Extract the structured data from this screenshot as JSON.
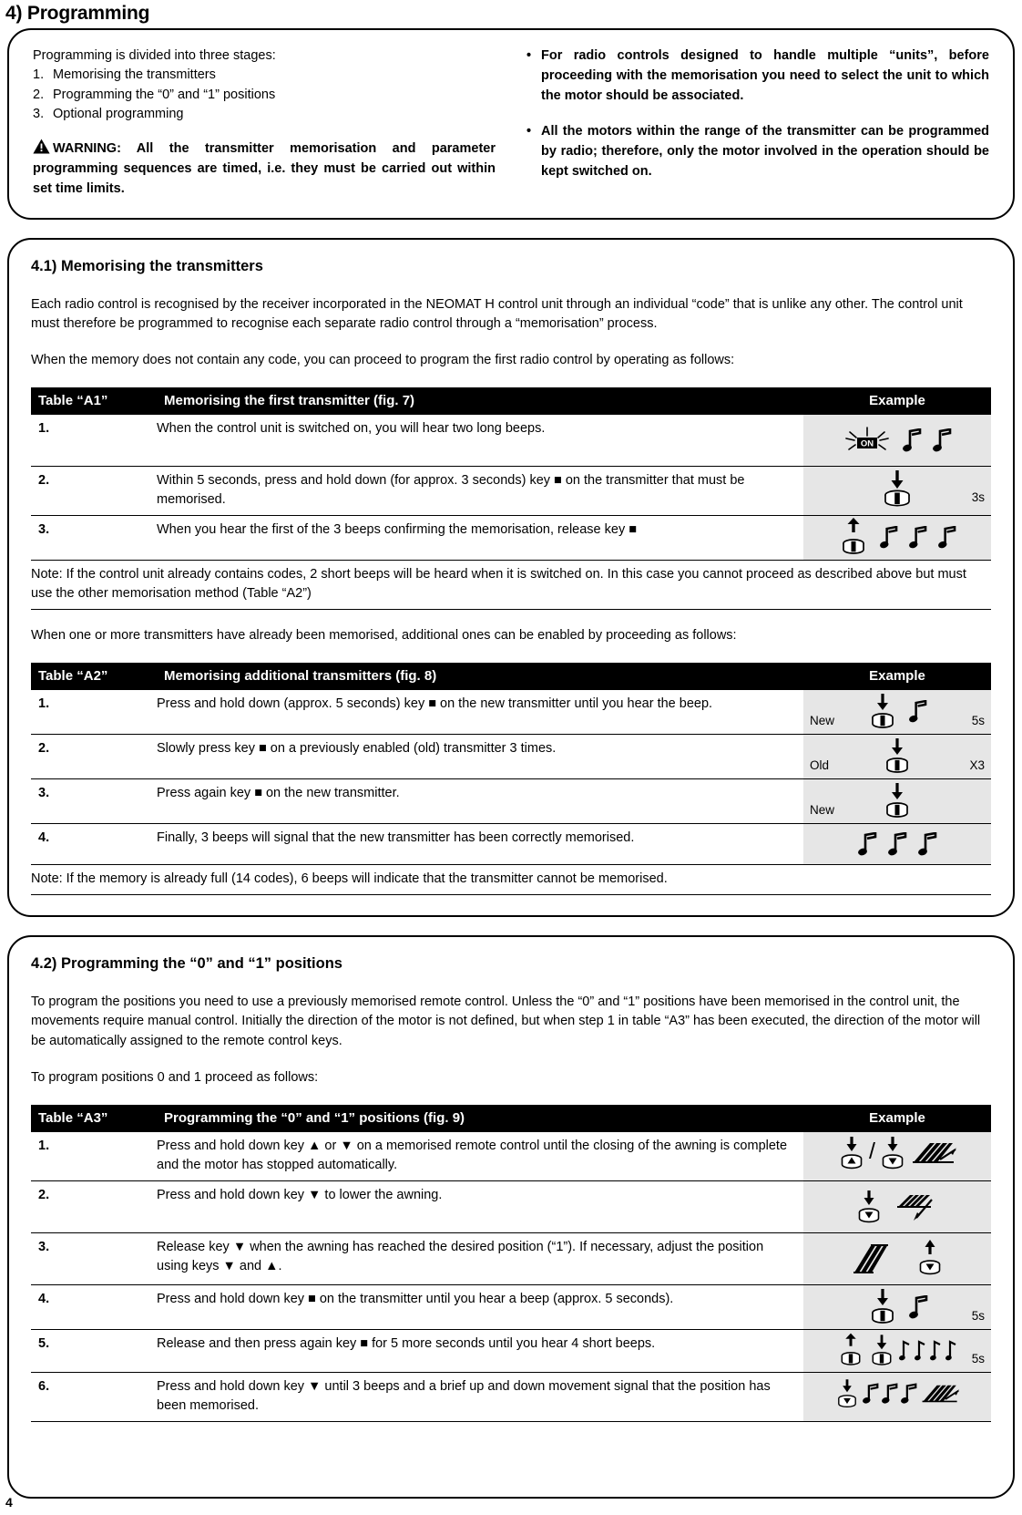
{
  "page": {
    "section_number_title": "4) Programming",
    "folio": "4"
  },
  "intro": {
    "lead": "Programming is divided into three stages:",
    "stages": [
      {
        "num": "1.",
        "text": "Memorising the transmitters"
      },
      {
        "num": "2.",
        "text": "Programming the “0” and “1” positions"
      },
      {
        "num": "3.",
        "text": "Optional programming"
      }
    ],
    "warning_icon": "warning-triangle-icon",
    "warning": "WARNING: All the transmitter memorisation and parameter programming sequences are timed, i.e. they must be carried out within set time limits.",
    "bullets": [
      "For radio controls designed to handle multiple “units”, before proceeding with the memorisation you need to select the unit to which the motor should be associated.",
      "All the motors within the range of the transmitter can be programmed by radio; therefore, only the motor involved in the operation should be kept switched on."
    ]
  },
  "section_41": {
    "title": "4.1) Memorising the transmitters",
    "para1": "Each radio control is recognised by the receiver incorporated in the NEOMAT H control unit through an individual “code” that is unlike any other. The control unit must therefore be programmed to recognise each separate radio control through a “memorisation” process.",
    "para2": "When the memory does not contain any code, you can proceed to program the first radio control by operating as follows:",
    "table_a1": {
      "header": {
        "label": "Table “A1”",
        "title": "Memorising the first transmitter (fig. 7)",
        "example": "Example"
      },
      "rows": [
        {
          "step": "1.",
          "desc": "When the control unit is switched on, you will hear two long beeps.",
          "example_icons": "on-burst-icon, beep-note-icon, beep-note-icon"
        },
        {
          "step": "2.",
          "desc": "Within 5 seconds, press and hold down (for approx. 3 seconds) key ■ on the transmitter that must be memorised.",
          "example_icons": "arrow-down-icon, stop-key-button-icon",
          "example_right": "3s"
        },
        {
          "step": "3.",
          "desc": "When you hear the first of the 3 beeps confirming the memorisation, release key ■",
          "example_icons": "arrow-up-icon, stop-key-button-icon, beep-note-icon, beep-note-icon, beep-note-icon"
        }
      ],
      "note": "Note: If the control unit already contains codes, 2 short beeps will be heard when it is switched on. In this case you cannot proceed as described above but must use the other memorisation method (Table “A2”)"
    },
    "para3": "When one or more transmitters have already been memorised, additional ones can be enabled by proceeding as follows:",
    "table_a2": {
      "header": {
        "label": "Table “A2”",
        "title": "Memorising additional transmitters (fig. 8)",
        "example": "Example"
      },
      "rows": [
        {
          "step": "1.",
          "desc": "Press and hold down (approx. 5 seconds) key ■ on the new transmitter until you hear the beep.",
          "example_label": "New",
          "example_icons": "arrow-down-icon, stop-key-button-icon, beep-note-icon",
          "example_right": "5s"
        },
        {
          "step": "2.",
          "desc": "Slowly press key ■ on a previously enabled (old) transmitter 3 times.",
          "example_label": "Old",
          "example_icons": "arrow-down-icon, stop-key-button-icon",
          "example_right": "X3"
        },
        {
          "step": "3.",
          "desc": "Press again key ■ on the new transmitter.",
          "example_label": "New",
          "example_icons": "arrow-down-icon, stop-key-button-icon"
        },
        {
          "step": "4.",
          "desc": "Finally, 3 beeps will signal that the new transmitter has been correctly memorised.",
          "example_icons": "beep-note-icon, beep-note-icon, beep-note-icon"
        }
      ],
      "note": "Note: If the memory is already full (14 codes), 6 beeps will indicate that the transmitter cannot be memorised."
    }
  },
  "section_42": {
    "title": "4.2) Programming the “0” and “1” positions",
    "para1": "To program the positions you need to use a previously memorised remote control. Unless the “0” and “1” positions have been memorised in the control unit, the movements require manual control. Initially the direction of the motor is not defined, but when step 1 in table “A3” has been executed, the direction of the motor will be automatically assigned to the remote control keys.",
    "para2": "To program positions 0 and 1 proceed as follows:",
    "table_a3": {
      "header": {
        "label": "Table “A3”",
        "title": "Programming the “0” and “1” positions (fig. 9)",
        "example": "Example"
      },
      "rows": [
        {
          "step": "1.",
          "desc": "Press and hold down key ▲ or ▼ on a memorised remote control until the closing of the awning is complete and the motor has stopped automatically.",
          "example_icons": "arrow-down-icon, up-key-button-icon, slash-separator, arrow-down-icon, down-key-button-icon, awning-closed-icon"
        },
        {
          "step": "2.",
          "desc": "Press and hold down key ▼ to lower the awning.",
          "example_icons": "arrow-down-icon, down-key-button-icon, awning-opening-icon"
        },
        {
          "step": "3.",
          "desc": "Release key ▼ when the awning has reached the desired position (“1”). If necessary, adjust the position using keys ▼ and ▲.",
          "example_icons": "awning-open-icon, arrow-up-icon, down-key-button-icon"
        },
        {
          "step": "4.",
          "desc": "Press and hold down key ■ on the transmitter until you hear a beep (approx. 5 seconds).",
          "example_icons": "arrow-down-icon, stop-key-button-icon, beep-note-icon",
          "example_right": "5s"
        },
        {
          "step": "5.",
          "desc": "Release and then press again key ■ for 5 more seconds until you hear 4 short beeps.",
          "example_icons": "arrow-up-icon, stop-key-button-icon, arrow-down-icon, stop-key-button-icon, short-beep-icon, short-beep-icon, short-beep-icon, short-beep-icon",
          "example_right": "5s"
        },
        {
          "step": "6.",
          "desc": "Press and hold down key ▼ until 3 beeps and a brief up and down movement signal that the position has been memorised.",
          "example_icons": "arrow-down-icon, down-key-button-icon, beep-note-icon, beep-note-icon, beep-note-icon, awning-closed-icon"
        }
      ]
    }
  }
}
